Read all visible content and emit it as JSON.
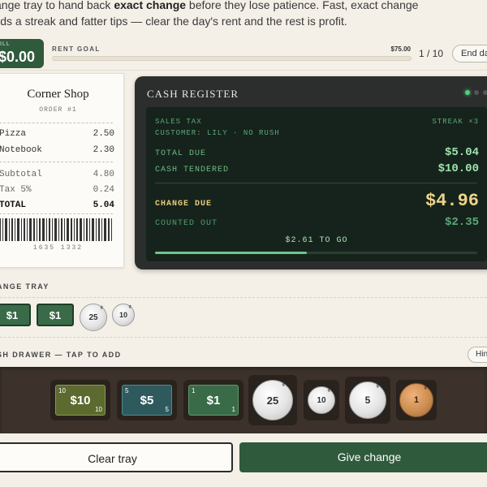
{
  "intro": {
    "line1_pre": "ange tray to hand back ",
    "line1_bold": "exact change",
    "line1_post": " before they lose patience. Fast, exact change",
    "line2": "ilds a streak and fatter tips — clear the day's rent and the rest is profit."
  },
  "topbar": {
    "till_label": "ILL",
    "till_amount": "$0.00",
    "goal_label": "RENT GOAL",
    "goal_amount": "$75.00",
    "goal_progress": 0,
    "round": "1 / 10",
    "end_day": "End day"
  },
  "receipt": {
    "shop": "Corner Shop",
    "order": "ORDER #1",
    "items": [
      {
        "name": "Pizza",
        "price": "2.50"
      },
      {
        "name": "Notebook",
        "price": "2.30"
      }
    ],
    "subtotal_label": "Subtotal",
    "subtotal": "4.80",
    "tax_label": "Tax 5%",
    "tax": "0.24",
    "total_label": "TOTAL",
    "total": "5.04",
    "code": "1635 1332"
  },
  "register": {
    "title": "CASH REGISTER",
    "sales_tax": "SALES TAX",
    "streak": "STREAK ×3",
    "customer": "CUSTOMER: LILY · NO RUSH",
    "total_due_label": "TOTAL DUE",
    "total_due": "$5.04",
    "cash_label": "CASH TENDERED",
    "cash": "$10.00",
    "change_label": "CHANGE DUE",
    "change": "$4.96",
    "counted_label": "COUNTED OUT",
    "counted": "$2.35",
    "to_go": "$2.61 TO GO",
    "progress": 0.47
  },
  "tray": {
    "label": "ANGE TRAY",
    "items": [
      {
        "kind": "bill",
        "label": "$1"
      },
      {
        "kind": "bill",
        "label": "$1"
      },
      {
        "kind": "coin",
        "label": "25"
      },
      {
        "kind": "coin",
        "label": "10"
      }
    ]
  },
  "drawer": {
    "label": "SH DRAWER — TAP TO ADD",
    "hint": "Hint",
    "bills": [
      {
        "label": "$10",
        "corner": "10"
      },
      {
        "label": "$5",
        "corner": "5"
      },
      {
        "label": "$1",
        "corner": "1"
      }
    ],
    "coins": [
      "25",
      "10",
      "5",
      "1"
    ],
    "coin_mark": "¢"
  },
  "buttons": {
    "clear": "Clear tray",
    "give": "Give change"
  },
  "colors": {
    "accent": "#2f5a3c",
    "screen": "#16231c",
    "bill_10": "#5c6a2f",
    "bill_5": "#2e5a5e",
    "bill_1": "#3a6b48",
    "penny": "#c98a4e"
  }
}
